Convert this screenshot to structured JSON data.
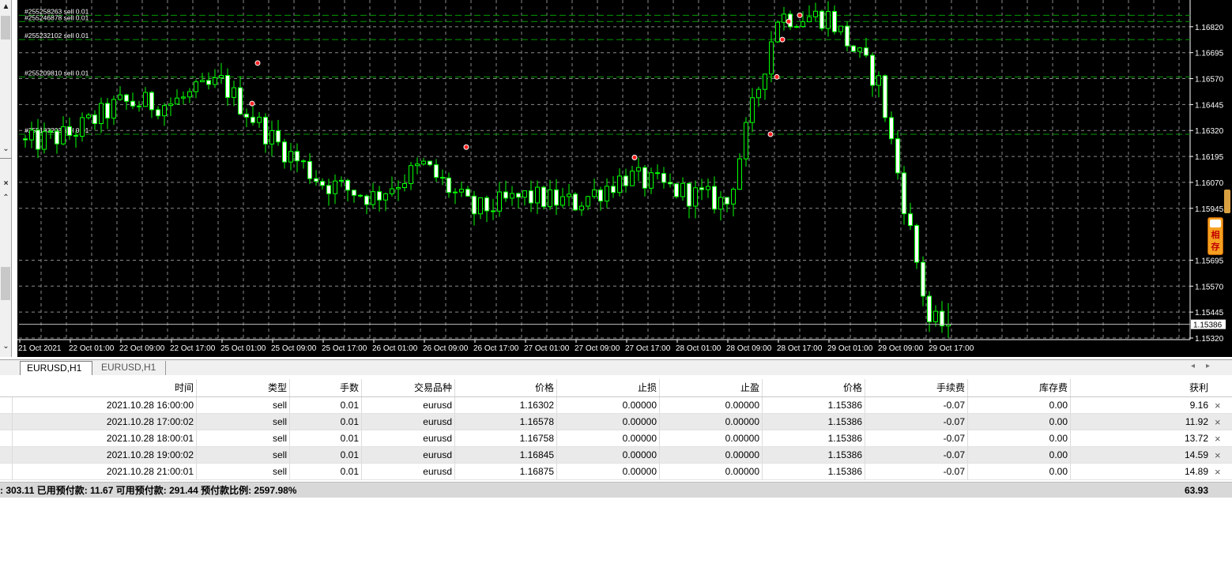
{
  "chart": {
    "symbol_tabs": [
      {
        "label": "EURUSD,H1",
        "active": true
      },
      {
        "label": "EURUSD,H1",
        "active": false
      }
    ],
    "price_axis_labels": [
      "1.16820",
      "1.16695",
      "1.16570",
      "1.16445",
      "1.16320",
      "1.16195",
      "1.16070",
      "1.15945",
      "1.15695",
      "1.15570",
      "1.15445",
      "1.15320"
    ],
    "current_price": "1.15386",
    "time_axis_labels": [
      "21 Oct 2021",
      "22 Oct 01:00",
      "22 Oct 09:00",
      "22 Oct 17:00",
      "25 Oct 01:00",
      "25 Oct 09:00",
      "25 Oct 17:00",
      "26 Oct 01:00",
      "26 Oct 09:00",
      "26 Oct 17:00",
      "27 Oct 01:00",
      "27 Oct 09:00",
      "27 Oct 17:00",
      "28 Oct 01:00",
      "28 Oct 09:00",
      "28 Oct 17:00",
      "29 Oct 01:00",
      "29 Oct 09:00",
      "29 Oct 17:00"
    ],
    "order_lines": [
      {
        "label": "#255258263 sell 0.01",
        "price": 1.16875
      },
      {
        "label": "#255246878 sell 0.01",
        "price": 1.16845
      },
      {
        "label": "#255232102 sell 0.01",
        "price": 1.16758
      },
      {
        "label": "#255209810 sell 0.01",
        "price": 1.16578
      },
      {
        "label": "#255183203 sell 0.01",
        "price": 1.16302
      }
    ],
    "colors": {
      "background": "#000000",
      "bull": "#00ff00",
      "grid": "#8a8a8a",
      "order_line": "#009900",
      "axis_text": "#ffffff"
    },
    "side_widget_text": "相存"
  },
  "chart_data": {
    "type": "candlestick",
    "symbol": "EURUSD",
    "timeframe": "H1",
    "ylim": [
      1.1532,
      1.1695
    ],
    "grid": true,
    "x": [
      "21 Oct 2021",
      "22 Oct 01:00",
      "22 Oct 09:00",
      "22 Oct 17:00",
      "25 Oct 01:00",
      "25 Oct 09:00",
      "25 Oct 17:00",
      "26 Oct 01:00",
      "26 Oct 09:00",
      "26 Oct 17:00",
      "27 Oct 01:00",
      "27 Oct 09:00",
      "27 Oct 17:00",
      "28 Oct 01:00",
      "28 Oct 09:00",
      "28 Oct 17:00",
      "29 Oct 01:00",
      "29 Oct 09:00",
      "29 Oct 17:00"
    ],
    "close": [
      1.1625,
      1.163,
      1.1645,
      1.1645,
      1.1655,
      1.1628,
      1.1607,
      1.16,
      1.1615,
      1.1593,
      1.16,
      1.1597,
      1.161,
      1.1603,
      1.1597,
      1.1687,
      1.1687,
      1.1655,
      1.154
    ],
    "current_price": 1.15386
  },
  "trades": {
    "columns": [
      "时间",
      "类型",
      "手数",
      "交易品种",
      "价格",
      "止损",
      "止盈",
      "价格",
      "手续费",
      "库存费",
      "获利"
    ],
    "rows": [
      {
        "time": "2021.10.28 16:00:00",
        "type": "sell",
        "lots": "0.01",
        "symbol": "eurusd",
        "open_price": "1.16302",
        "sl": "0.00000",
        "tp": "0.00000",
        "price": "1.15386",
        "commission": "-0.07",
        "swap": "0.00",
        "profit": "9.16"
      },
      {
        "time": "2021.10.28 17:00:02",
        "type": "sell",
        "lots": "0.01",
        "symbol": "eurusd",
        "open_price": "1.16578",
        "sl": "0.00000",
        "tp": "0.00000",
        "price": "1.15386",
        "commission": "-0.07",
        "swap": "0.00",
        "profit": "11.92"
      },
      {
        "time": "2021.10.28 18:00:01",
        "type": "sell",
        "lots": "0.01",
        "symbol": "eurusd",
        "open_price": "1.16758",
        "sl": "0.00000",
        "tp": "0.00000",
        "price": "1.15386",
        "commission": "-0.07",
        "swap": "0.00",
        "profit": "13.72"
      },
      {
        "time": "2021.10.28 19:00:02",
        "type": "sell",
        "lots": "0.01",
        "symbol": "eurusd",
        "open_price": "1.16845",
        "sl": "0.00000",
        "tp": "0.00000",
        "price": "1.15386",
        "commission": "-0.07",
        "swap": "0.00",
        "profit": "14.59"
      },
      {
        "time": "2021.10.28 21:00:01",
        "type": "sell",
        "lots": "0.01",
        "symbol": "eurusd",
        "open_price": "1.16875",
        "sl": "0.00000",
        "tp": "0.00000",
        "price": "1.15386",
        "commission": "-0.07",
        "swap": "0.00",
        "profit": "14.89"
      }
    ]
  },
  "summary": {
    "text": ": 303.11  已用预付款: 11.67  可用预付款: 291.44  预付款比例: 2597.98%",
    "total_profit": "63.93"
  }
}
